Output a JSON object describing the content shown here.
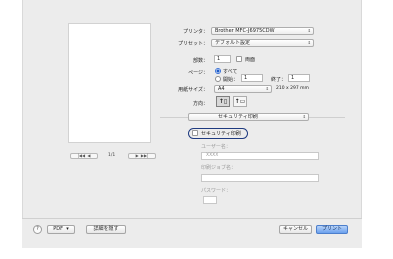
{
  "printer": {
    "label": "プリンタ：",
    "value": "Brother MFC-J6975CDW"
  },
  "preset": {
    "label": "プリセット：",
    "value": "デフォルト設定"
  },
  "copies": {
    "label": "部数：",
    "value": "1",
    "collate_label": "両面"
  },
  "pages": {
    "label": "ページ：",
    "all_label": "すべて",
    "from_label": "開始：",
    "from_value": "1",
    "to_label": "終了：",
    "to_value": "1"
  },
  "paper_size": {
    "label": "用紙サイズ：",
    "value": "A4",
    "dimensions": "210 x 297 mm"
  },
  "orientation": {
    "label": "方向："
  },
  "section_menu": {
    "value": "セキュリティ印刷"
  },
  "secure_print": {
    "checkbox_label": "セキュリティ印刷",
    "user_name_label": "ユーザー名：",
    "user_name_value": "XXXX",
    "job_name_label": "印刷ジョブ名：",
    "password_label": "パスワード："
  },
  "preview_nav": {
    "page_text": "1/1"
  },
  "footer": {
    "help_glyph": "?",
    "pdf_label": "PDF",
    "hide_details_label": "詳細を隠す",
    "cancel_label": "キャンセル",
    "print_label": "プリント"
  },
  "colors": {
    "accent": "#3a72d8",
    "highlight_ring": "#1f3b80",
    "dialog_bg": "#ececec"
  },
  "icons": [
    "chevron-updown-icon",
    "first-page-icon",
    "prev-page-icon",
    "next-page-icon",
    "last-page-icon",
    "portrait-icon",
    "landscape-icon",
    "help-icon"
  ]
}
